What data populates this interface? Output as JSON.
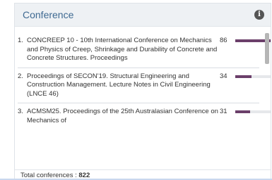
{
  "widget": {
    "title": "Conference",
    "info_icon": "info-icon",
    "items": [
      {
        "rank": "1.",
        "name": "CONCREEP 10 - 10th International Conference on Mechanics and Physics of Creep, Shrinkage and Durability of Concrete and Concrete Structures. Proceedings",
        "count": "86",
        "bar_fraction": 1.0
      },
      {
        "rank": "2.",
        "name": "Proceedings of SECON'19. Structural Engineering and Construction Management. Lecture Notes in Civil Engineering (LNCE 46)",
        "count": "34",
        "bar_fraction": 0.4
      },
      {
        "rank": "3.",
        "name": "ACMSM25. Proceedings of the 25th Australasian Conference on Mechanics of",
        "count": "31",
        "bar_fraction": 0.36
      }
    ],
    "footer_label": "Total conferences : ",
    "footer_value": "822",
    "colors": {
      "bar": "#6b3f6a",
      "title": "#3f6a92"
    }
  }
}
